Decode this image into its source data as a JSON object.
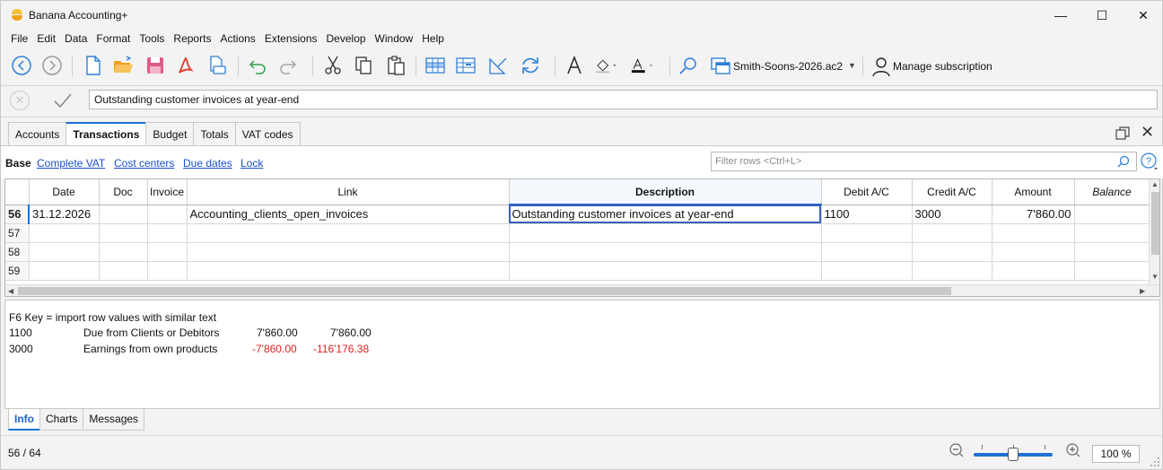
{
  "window": {
    "title": "Banana Accounting+",
    "minimize_glyph": "—",
    "maximize_glyph": "☐",
    "close_glyph": "✕"
  },
  "menu": [
    {
      "label": "File"
    },
    {
      "label": "Edit"
    },
    {
      "label": "Data"
    },
    {
      "label": "Format"
    },
    {
      "label": "Tools"
    },
    {
      "label": "Reports"
    },
    {
      "label": "Actions"
    },
    {
      "label": "Extensions"
    },
    {
      "label": "Develop"
    },
    {
      "label": "Window"
    },
    {
      "label": "Help"
    }
  ],
  "toolbar": {
    "file_name": "Smith-Soons-2026.ac2",
    "manage_subscription": "Manage subscription"
  },
  "editbar": {
    "value": "Outstanding customer invoices at year-end"
  },
  "tabs": [
    {
      "label": "Accounts"
    },
    {
      "label": "Transactions"
    },
    {
      "label": "Budget"
    },
    {
      "label": "Totals"
    },
    {
      "label": "VAT codes"
    }
  ],
  "views": {
    "base": "Base",
    "complete_vat": "Complete VAT",
    "cost_centers": "Cost centers",
    "due_dates": "Due dates",
    "lock": "Lock"
  },
  "filter": {
    "placeholder": "Filter rows <Ctrl+L>"
  },
  "grid": {
    "columns": [
      "Date",
      "Doc",
      "Invoice",
      "Link",
      "Description",
      "Debit A/C",
      "Credit A/C",
      "Amount",
      "Balance"
    ],
    "rows": [
      {
        "num": "56",
        "date": "31.12.2026",
        "doc": "",
        "invoice": "",
        "link": "Accounting_clients_open_invoices",
        "description": "Outstanding customer invoices at year-end",
        "debit": "1100",
        "credit": "3000",
        "amount": "7'860.00",
        "balance": ""
      },
      {
        "num": "57",
        "date": "",
        "doc": "",
        "invoice": "",
        "link": "",
        "description": "",
        "debit": "",
        "credit": "",
        "amount": "",
        "balance": ""
      },
      {
        "num": "58",
        "date": "",
        "doc": "",
        "invoice": "",
        "link": "",
        "description": "",
        "debit": "",
        "credit": "",
        "amount": "",
        "balance": ""
      },
      {
        "num": "59",
        "date": "",
        "doc": "",
        "invoice": "",
        "link": "",
        "description": "",
        "debit": "",
        "credit": "",
        "amount": "",
        "balance": ""
      }
    ]
  },
  "info": {
    "hint": "F6 Key = import row values with similar text",
    "lines": [
      {
        "account": "1100",
        "name": "Due from Clients or Debitors",
        "amount": "7'860.00",
        "balance": "7'860.00"
      },
      {
        "account": "3000",
        "name": "Earnings from own products",
        "amount": "-7'860.00",
        "balance": "-116'176.38"
      }
    ]
  },
  "bottom_tabs": [
    {
      "label": "Info"
    },
    {
      "label": "Charts"
    },
    {
      "label": "Messages"
    }
  ],
  "status": {
    "position": "56 / 64",
    "zoom": "100 %"
  },
  "colors": {
    "accent": "#1e6fd1",
    "negative": "#e02020",
    "icon_blue": "#2f7fd8",
    "pdf_red": "#e03a2a",
    "folder_orange": "#f0a020"
  }
}
